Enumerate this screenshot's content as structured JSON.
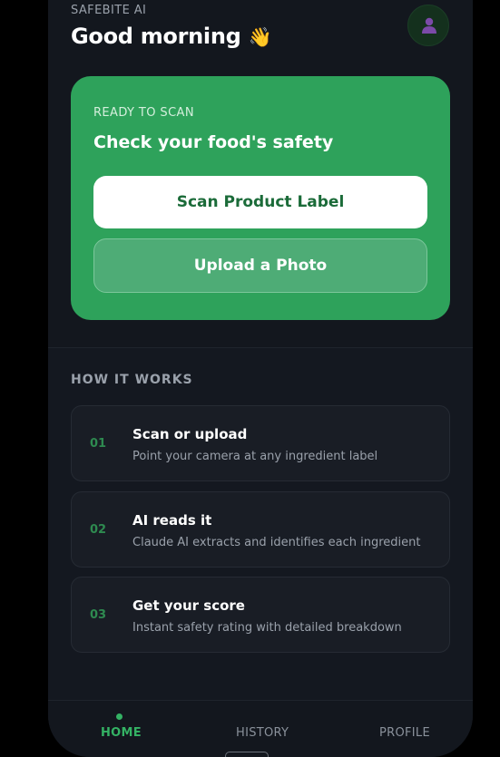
{
  "header": {
    "app_label": "SAFEBITE AI",
    "greeting": "Good morning",
    "greeting_emoji": "👋",
    "avatar_icon": "user-icon"
  },
  "scan_card": {
    "eyebrow": "READY TO SCAN",
    "title": "Check your food's safety",
    "scan_button_label": "Scan Product Label",
    "upload_button_label": "Upload a Photo",
    "background_color": "#2ea25b"
  },
  "how_it_works": {
    "heading": "HOW IT WORKS",
    "steps": [
      {
        "number": "01",
        "title": "Scan or upload",
        "description": "Point your camera at any ingredient label"
      },
      {
        "number": "02",
        "title": "AI reads it",
        "description": "Claude AI extracts and identifies each ingredient"
      },
      {
        "number": "03",
        "title": "Get your score",
        "description": "Instant safety rating with detailed breakdown"
      }
    ]
  },
  "bottom_nav": {
    "items": [
      {
        "label": "HOME",
        "active": true
      },
      {
        "label": "HISTORY",
        "active": false
      },
      {
        "label": "PROFILE",
        "active": false
      }
    ],
    "accent_color": "#34b264"
  }
}
